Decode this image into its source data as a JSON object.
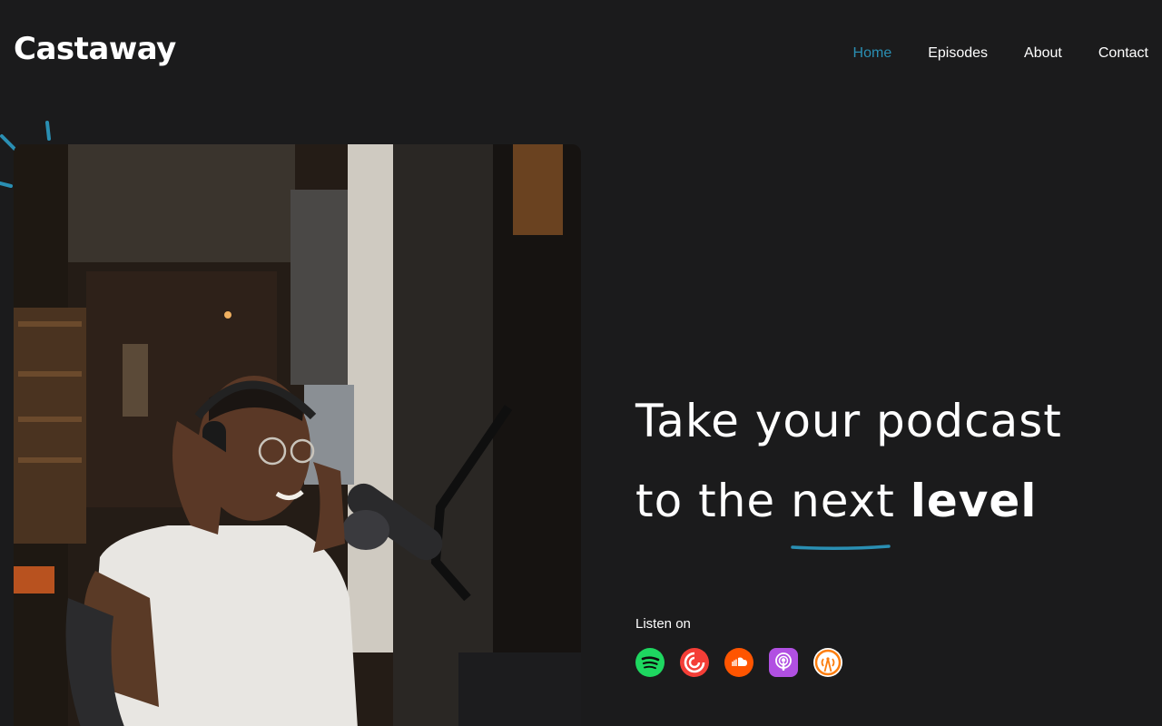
{
  "brand": {
    "name": "Castaway"
  },
  "nav": {
    "items": [
      {
        "label": "Home",
        "active": true
      },
      {
        "label": "Episodes",
        "active": false
      },
      {
        "label": "About",
        "active": false
      },
      {
        "label": "Contact",
        "active": false
      }
    ]
  },
  "hero": {
    "line1": "Take your podcast",
    "line2_prefix": "to the",
    "line2_underlined": "next",
    "line2_bold": "level",
    "image_alt": "Man wearing headphones speaking into a studio microphone"
  },
  "listen": {
    "label": "Listen on",
    "platforms": [
      {
        "name": "Spotify",
        "icon": "spotify-icon",
        "color": "#1ed760"
      },
      {
        "name": "Pocket Casts",
        "icon": "pocket-casts-icon",
        "color": "#f43e37"
      },
      {
        "name": "SoundCloud",
        "icon": "soundcloud-icon",
        "color": "#ff5500"
      },
      {
        "name": "Apple Podcasts",
        "icon": "apple-podcasts-icon",
        "color": "#b150e2"
      },
      {
        "name": "Overcast",
        "icon": "overcast-icon",
        "color": "#fc7e0f"
      }
    ]
  },
  "colors": {
    "accent": "#2a8fb3",
    "background": "#1b1b1c",
    "text": "#ffffff"
  }
}
